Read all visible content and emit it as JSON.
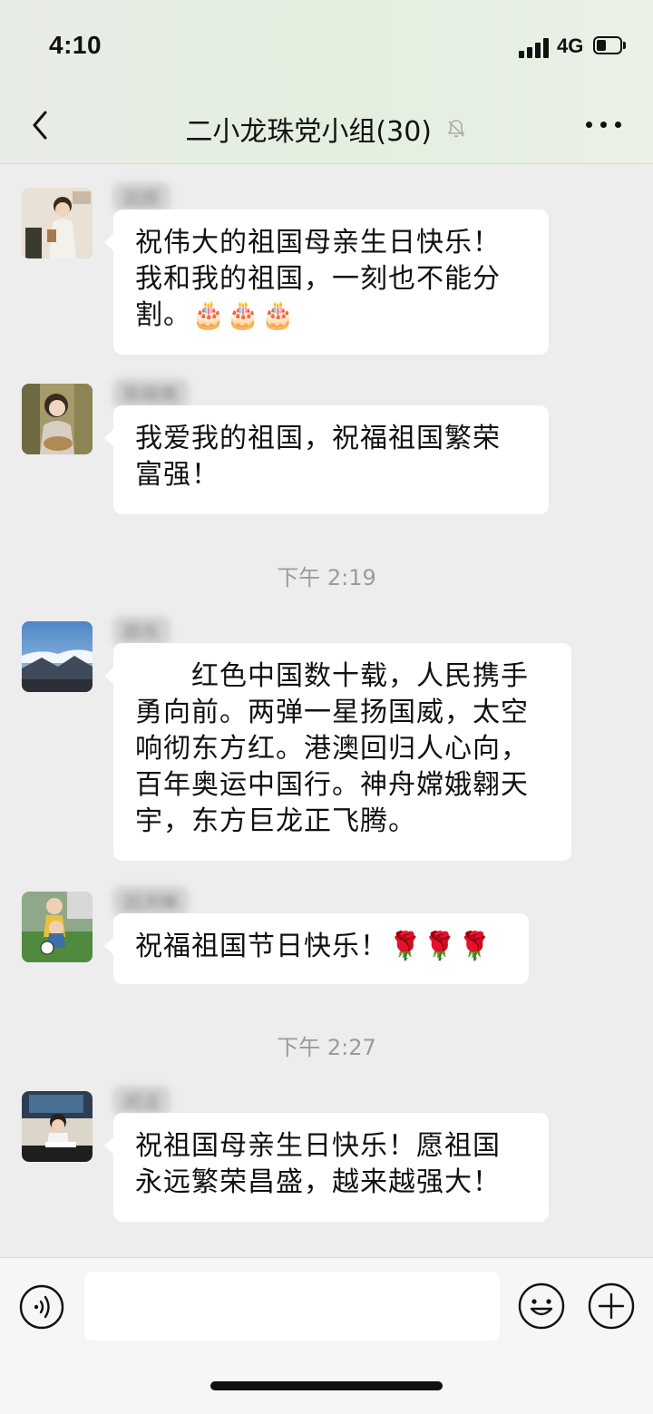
{
  "status_bar": {
    "time": "4:10",
    "network": "4G"
  },
  "header": {
    "title": "二小龙珠党小组(30)"
  },
  "messages": [
    {
      "sender": "田原",
      "text": "祝伟大的祖国母亲生日快乐！我和我的祖国，一刻也不能分割。🎂🎂🎂"
    },
    {
      "sender": "陈晓艳",
      "text": "我爱我的祖国，祝福祖国繁荣富强！"
    },
    {
      "sender": "顾东",
      "text": "　　红色中国数十载，人民携手勇向前。两弹一星扬国威，太空响彻东方红。港澳回归人心向，百年奥运中国行。神舟嫦娥翱天宇，东方巨龙正飞腾。"
    },
    {
      "sender": "田洪琳",
      "text": "祝福祖国节日快乐！🌹🌹🌹"
    },
    {
      "sender": "闵洁",
      "text": "祝祖国母亲生日快乐！愿祖国永远繁荣昌盛，越来越强大！"
    }
  ],
  "timestamps": [
    "下午 2:19",
    "下午 2:27"
  ],
  "input": {
    "value": ""
  }
}
